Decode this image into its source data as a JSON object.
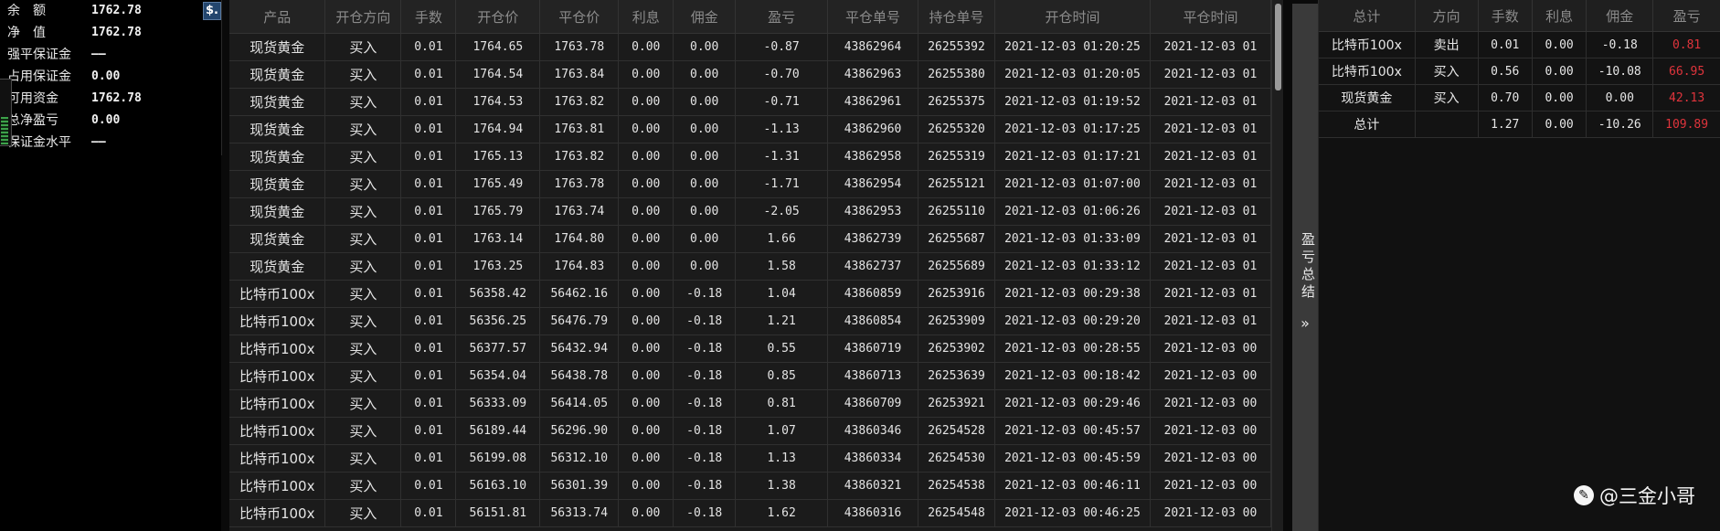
{
  "account": {
    "rows": [
      {
        "label": "余　额",
        "value": "1762.78"
      },
      {
        "label": "净　值",
        "value": "1762.78"
      },
      {
        "label": "强平保证金",
        "value": "——"
      },
      {
        "label": "占用保证金",
        "value": "0.00"
      },
      {
        "label": "可用资金",
        "value": "1762.78"
      },
      {
        "label": "总净盈亏",
        "value": "0.00"
      },
      {
        "label": "保证金水平",
        "value": "——"
      }
    ],
    "dollar_button": "$."
  },
  "history": {
    "columns": [
      "产品",
      "开仓方向",
      "手数",
      "开仓价",
      "平仓价",
      "利息",
      "佣金",
      "盈亏",
      "平仓单号",
      "持仓单号",
      "开仓时间",
      "平仓时间"
    ],
    "rows": [
      [
        "现货黄金",
        "买入",
        "0.01",
        "1764.65",
        "1763.78",
        "0.00",
        "0.00",
        "-0.87",
        "43862964",
        "26255392",
        "2021-12-03 01:20:25",
        "2021-12-03 01"
      ],
      [
        "现货黄金",
        "买入",
        "0.01",
        "1764.54",
        "1763.84",
        "0.00",
        "0.00",
        "-0.70",
        "43862963",
        "26255380",
        "2021-12-03 01:20:05",
        "2021-12-03 01"
      ],
      [
        "现货黄金",
        "买入",
        "0.01",
        "1764.53",
        "1763.82",
        "0.00",
        "0.00",
        "-0.71",
        "43862961",
        "26255375",
        "2021-12-03 01:19:52",
        "2021-12-03 01"
      ],
      [
        "现货黄金",
        "买入",
        "0.01",
        "1764.94",
        "1763.81",
        "0.00",
        "0.00",
        "-1.13",
        "43862960",
        "26255320",
        "2021-12-03 01:17:25",
        "2021-12-03 01"
      ],
      [
        "现货黄金",
        "买入",
        "0.01",
        "1765.13",
        "1763.82",
        "0.00",
        "0.00",
        "-1.31",
        "43862958",
        "26255319",
        "2021-12-03 01:17:21",
        "2021-12-03 01"
      ],
      [
        "现货黄金",
        "买入",
        "0.01",
        "1765.49",
        "1763.78",
        "0.00",
        "0.00",
        "-1.71",
        "43862954",
        "26255121",
        "2021-12-03 01:07:00",
        "2021-12-03 01"
      ],
      [
        "现货黄金",
        "买入",
        "0.01",
        "1765.79",
        "1763.74",
        "0.00",
        "0.00",
        "-2.05",
        "43862953",
        "26255110",
        "2021-12-03 01:06:26",
        "2021-12-03 01"
      ],
      [
        "现货黄金",
        "买入",
        "0.01",
        "1763.14",
        "1764.80",
        "0.00",
        "0.00",
        "1.66",
        "43862739",
        "26255687",
        "2021-12-03 01:33:09",
        "2021-12-03 01"
      ],
      [
        "现货黄金",
        "买入",
        "0.01",
        "1763.25",
        "1764.83",
        "0.00",
        "0.00",
        "1.58",
        "43862737",
        "26255689",
        "2021-12-03 01:33:12",
        "2021-12-03 01"
      ],
      [
        "比特币100x",
        "买入",
        "0.01",
        "56358.42",
        "56462.16",
        "0.00",
        "-0.18",
        "1.04",
        "43860859",
        "26253916",
        "2021-12-03 00:29:38",
        "2021-12-03 01"
      ],
      [
        "比特币100x",
        "买入",
        "0.01",
        "56356.25",
        "56476.79",
        "0.00",
        "-0.18",
        "1.21",
        "43860854",
        "26253909",
        "2021-12-03 00:29:20",
        "2021-12-03 01"
      ],
      [
        "比特币100x",
        "买入",
        "0.01",
        "56377.57",
        "56432.94",
        "0.00",
        "-0.18",
        "0.55",
        "43860719",
        "26253902",
        "2021-12-03 00:28:55",
        "2021-12-03 00"
      ],
      [
        "比特币100x",
        "买入",
        "0.01",
        "56354.04",
        "56438.78",
        "0.00",
        "-0.18",
        "0.85",
        "43860713",
        "26253639",
        "2021-12-03 00:18:42",
        "2021-12-03 00"
      ],
      [
        "比特币100x",
        "买入",
        "0.01",
        "56333.09",
        "56414.05",
        "0.00",
        "-0.18",
        "0.81",
        "43860709",
        "26253921",
        "2021-12-03 00:29:46",
        "2021-12-03 00"
      ],
      [
        "比特币100x",
        "买入",
        "0.01",
        "56189.44",
        "56296.90",
        "0.00",
        "-0.18",
        "1.07",
        "43860346",
        "26254528",
        "2021-12-03 00:45:57",
        "2021-12-03 00"
      ],
      [
        "比特币100x",
        "买入",
        "0.01",
        "56199.08",
        "56312.10",
        "0.00",
        "-0.18",
        "1.13",
        "43860334",
        "26254530",
        "2021-12-03 00:45:59",
        "2021-12-03 00"
      ],
      [
        "比特币100x",
        "买入",
        "0.01",
        "56163.10",
        "56301.39",
        "0.00",
        "-0.18",
        "1.38",
        "43860321",
        "26254538",
        "2021-12-03 00:46:11",
        "2021-12-03 00"
      ],
      [
        "比特币100x",
        "买入",
        "0.01",
        "56151.81",
        "56313.74",
        "0.00",
        "-0.18",
        "1.62",
        "43860316",
        "26254548",
        "2021-12-03 00:46:25",
        "2021-12-03 00"
      ]
    ]
  },
  "summary_tab": {
    "label": "盈亏总结",
    "chevron": "»"
  },
  "summary": {
    "columns": [
      "总计",
      "方向",
      "手数",
      "利息",
      "佣金",
      "盈亏"
    ],
    "rows": [
      [
        "比特币100x",
        "卖出",
        "0.01",
        "0.00",
        "-0.18",
        "0.81"
      ],
      [
        "比特币100x",
        "买入",
        "0.56",
        "0.00",
        "-10.08",
        "66.95"
      ],
      [
        "现货黄金",
        "买入",
        "0.70",
        "0.00",
        "0.00",
        "42.13"
      ],
      [
        "总计",
        "",
        "1.27",
        "0.00",
        "-10.26",
        "109.89"
      ]
    ]
  },
  "colors": {
    "profit": "#e0343c",
    "loss": "#3fae3f"
  },
  "watermark": {
    "icon": "toutiao-icon",
    "text": "@三金小哥"
  }
}
